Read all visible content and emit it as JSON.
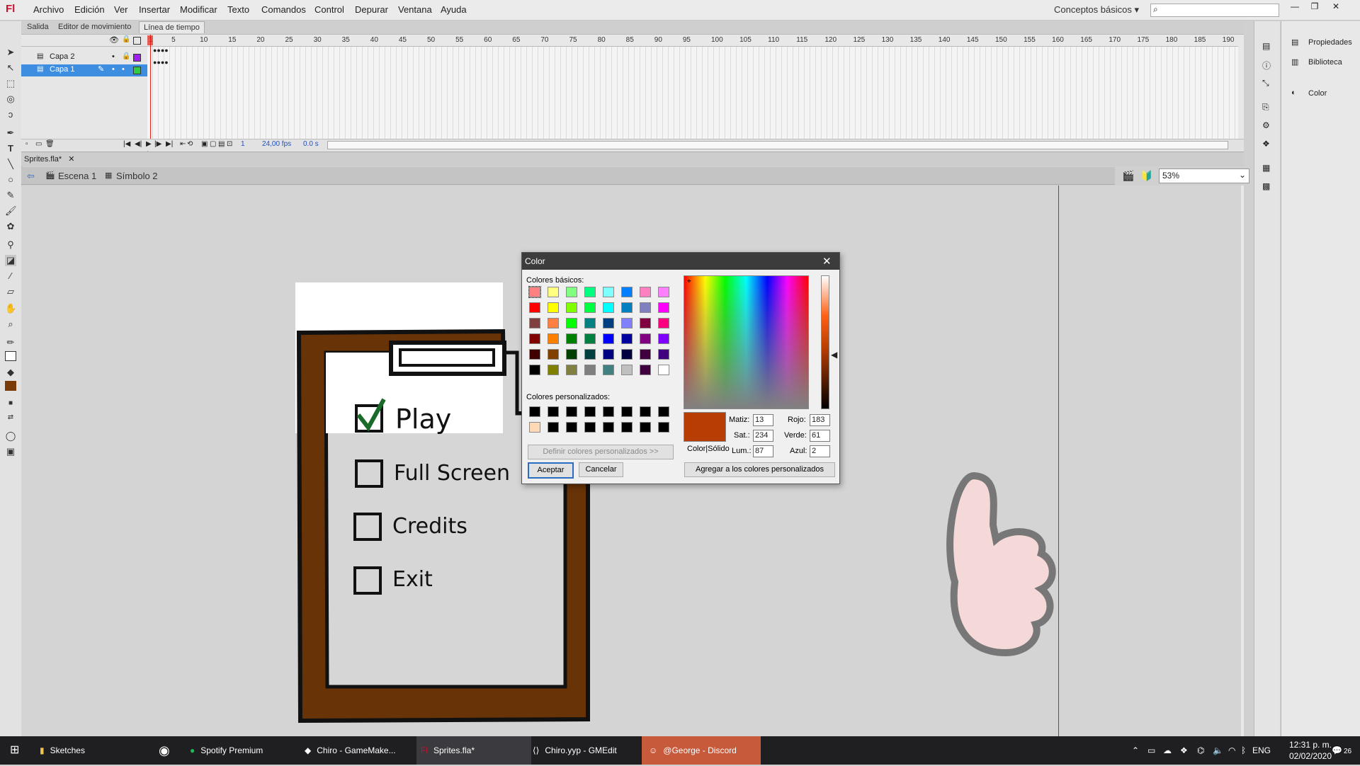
{
  "app": {
    "logo": "Fl"
  },
  "menu": [
    "Archivo",
    "Edición",
    "Ver",
    "Insertar",
    "Modificar",
    "Texto",
    "Comandos",
    "Control",
    "Depurar",
    "Ventana",
    "Ayuda"
  ],
  "workspace_label": "Conceptos básicos",
  "panel_tabs": [
    "Salida",
    "Editor de movimiento",
    "Línea de tiempo"
  ],
  "timeline": {
    "ticks": [
      "1",
      "5",
      "10",
      "15",
      "20",
      "25",
      "30",
      "35",
      "40",
      "45",
      "50",
      "55",
      "60",
      "65",
      "70",
      "75",
      "80",
      "85",
      "90",
      "95",
      "100",
      "105",
      "110",
      "115",
      "120",
      "125",
      "130",
      "135",
      "140",
      "145",
      "150",
      "155",
      "160",
      "165",
      "170",
      "175",
      "180",
      "185",
      "190"
    ],
    "layers": [
      {
        "name": "Capa 2",
        "color": "#a020f0"
      },
      {
        "name": "Capa 1",
        "color": "#2ecc40"
      }
    ],
    "footer": {
      "frame": "1",
      "fps": "24,00 fps",
      "time": "0.0 s"
    }
  },
  "document": {
    "tab": "Sprites.fla*",
    "breadcrumb": [
      "Escena 1",
      "Símbolo 2"
    ],
    "zoom": "53%"
  },
  "stage_art": {
    "options": [
      "Play",
      "Full Screen",
      "Credits",
      "Exit"
    ]
  },
  "right_panel": [
    "Propiedades",
    "Biblioteca",
    "Color"
  ],
  "color_dialog": {
    "title": "Color",
    "basic_label": "Colores básicos:",
    "custom_label": "Colores personalizados:",
    "define_button": "Definir colores personalizados >>",
    "ok_button": "Aceptar",
    "cancel_button": "Cancelar",
    "add_button": "Agregar a los colores personalizados",
    "preview_label": "Color|Sólido",
    "matiz_label": "Matiz:",
    "matiz": "13",
    "sat_label": "Sat.:",
    "sat": "234",
    "lum_label": "Lum.:",
    "lum": "87",
    "rojo_label": "Rojo:",
    "rojo": "183",
    "verde_label": "Verde:",
    "verde": "61",
    "azul_label": "Azul:",
    "azul": "2",
    "preview_color": "#b73d02",
    "basic_colors": [
      "#ff8080",
      "#ffff80",
      "#80ff80",
      "#00ff80",
      "#80ffff",
      "#0080ff",
      "#ff80c0",
      "#ff80ff",
      "#ff0000",
      "#ffff00",
      "#80ff00",
      "#00ff40",
      "#00ffff",
      "#0080c0",
      "#8080c0",
      "#ff00ff",
      "#804040",
      "#ff8040",
      "#00ff00",
      "#008080",
      "#004080",
      "#8080ff",
      "#800040",
      "#ff0080",
      "#800000",
      "#ff8000",
      "#008000",
      "#008040",
      "#0000ff",
      "#0000a0",
      "#800080",
      "#8000ff",
      "#400000",
      "#804000",
      "#004000",
      "#004040",
      "#000080",
      "#000040",
      "#400040",
      "#400080",
      "#000000",
      "#808000",
      "#808040",
      "#808080",
      "#408080",
      "#c0c0c0",
      "#400040",
      "#ffffff"
    ],
    "custom_colors": [
      "#000000",
      "#000000",
      "#000000",
      "#000000",
      "#000000",
      "#000000",
      "#000000",
      "#000000",
      "#fdd9b5",
      "#000000",
      "#000000",
      "#000000",
      "#000000",
      "#000000",
      "#000000",
      "#000000"
    ]
  },
  "taskbar": {
    "items": [
      "Sketches",
      "Spotify Premium",
      "Chiro - GameMake...",
      "Sprites.fla*",
      "Chiro.yyp - GMEdit",
      "@George - Discord"
    ],
    "lang": "ENG",
    "time": "12:31 p. m.",
    "date": "02/02/2020",
    "notifications": "26"
  }
}
